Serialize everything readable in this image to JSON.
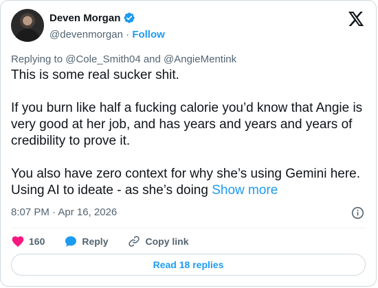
{
  "author": {
    "name": "Deven Morgan",
    "handle": "@devenmorgan",
    "separator": "·",
    "follow_label": "Follow"
  },
  "reply_to": "Replying to @Cole_Smith04 and @AngieMentink",
  "tweet": {
    "paragraphs": [
      "This is some real sucker shit.",
      "If you burn like half a fucking calorie you’d know that Angie is very good at her job, and has years and years and years of credibility to prove it.",
      "You also have zero context for why she’s using Gemini here. Using AI to ideate - as she’s doing"
    ],
    "show_more_label": "Show more"
  },
  "timestamp": "8:07 PM · Apr 16, 2026",
  "actions": {
    "like_count": "160",
    "reply_label": "Reply",
    "copy_link_label": "Copy link"
  },
  "read_replies_label": "Read 18 replies",
  "colors": {
    "accent": "#1d9bf0",
    "like": "#f91880",
    "secondary_text": "#536471",
    "border": "#cfd9de"
  },
  "icons": [
    "verified-badge-icon",
    "x-logo-icon",
    "info-icon",
    "heart-icon",
    "reply-bubble-icon",
    "link-icon"
  ]
}
